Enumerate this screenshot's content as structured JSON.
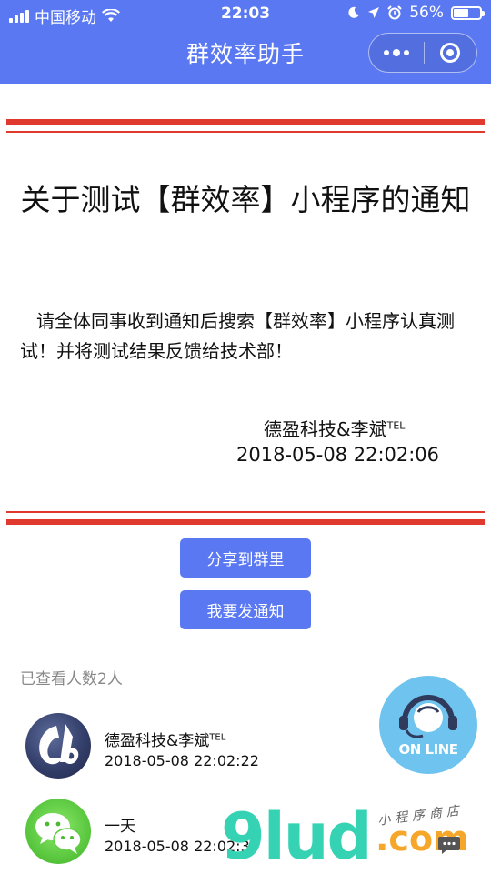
{
  "status_bar": {
    "carrier": "中国移动",
    "time": "22:03",
    "battery": "56%",
    "battery_level": 0.56
  },
  "nav": {
    "title": "群效率助手"
  },
  "notice": {
    "title": "关于测试【群效率】小程序的通知",
    "body": "请全体同事收到通知后搜索【群效率】小程序认真测试！并将测试结果反馈给技术部！",
    "signature": "德盈科技&李斌",
    "signature_sup": "TEL",
    "date": "2018-05-08 22:02:06"
  },
  "buttons": {
    "share": "分享到群里",
    "send": "我要发通知"
  },
  "viewers": {
    "count_label": "已查看人数2人",
    "items": [
      {
        "name": "德盈科技&李斌",
        "name_sup": "TEL",
        "time": "2018-05-08 22:02:22"
      },
      {
        "name": "一天",
        "name_sup": "",
        "time": "2018-05-08 22:02:34"
      }
    ]
  },
  "online_button": {
    "label": "ON LINE"
  },
  "watermark": {
    "main": "9lud",
    "domain": ".com",
    "tagline": "小程序商店"
  }
}
